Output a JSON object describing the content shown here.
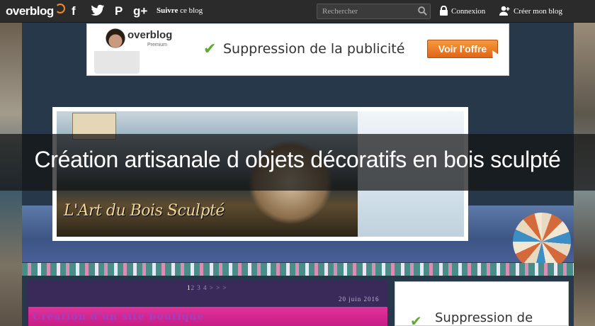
{
  "topbar": {
    "logo_text": "overblog",
    "social": [
      "f",
      "t",
      "P",
      "g+"
    ],
    "suivre_bold": "Suivre",
    "suivre_rest": "ce blog",
    "search_placeholder": "Rechercher",
    "connexion_label": "Connexion",
    "creer_label": "Créer mon blog"
  },
  "ad_banner": {
    "brand": "overblog",
    "tier": "Premium",
    "message": "Suppression de la publicité",
    "button_label": "Voir l'offre"
  },
  "header": {
    "signature": "L'Art du Bois Sculpté"
  },
  "blog_title": "Création artisanale d objets décoratifs en bois sculpté",
  "pagination": {
    "current": "1",
    "others": "2 3 4 > > >"
  },
  "post": {
    "date": "20 juin 2016",
    "title": "Création d'un site boutique"
  },
  "sidebar_ad": {
    "message": "Suppression de"
  },
  "colors": {
    "topbar": "#2b2b2b",
    "accent_orange": "#f08a24",
    "post_title_bg": "#e0329a",
    "check_green": "#5fa833"
  }
}
